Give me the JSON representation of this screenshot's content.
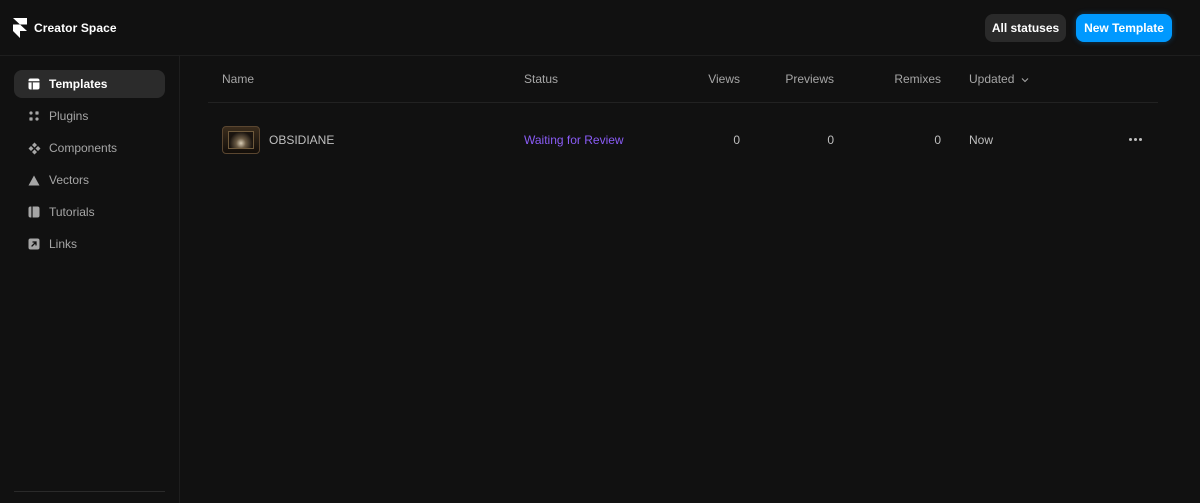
{
  "brand": {
    "name": "Creator Space",
    "logo_icon": "framer-logo-icon"
  },
  "header": {
    "status_filter_label": "All statuses",
    "new_template_label": "New Template",
    "accent_color": "#0099ff"
  },
  "sidebar": {
    "items": [
      {
        "label": "Templates",
        "icon": "template-icon",
        "active": true
      },
      {
        "label": "Plugins",
        "icon": "plugin-icon",
        "active": false
      },
      {
        "label": "Components",
        "icon": "components-icon",
        "active": false
      },
      {
        "label": "Vectors",
        "icon": "vector-triangle-icon",
        "active": false
      },
      {
        "label": "Tutorials",
        "icon": "book-icon",
        "active": false
      },
      {
        "label": "Links",
        "icon": "link-arrow-icon",
        "active": false
      }
    ]
  },
  "table": {
    "columns": {
      "name": "Name",
      "status": "Status",
      "views": "Views",
      "previews": "Previews",
      "remixes": "Remixes",
      "updated": "Updated"
    },
    "rows": [
      {
        "name": "OBSIDIANE",
        "status": "Waiting for Review",
        "status_color": "#8a5cf6",
        "views": "0",
        "previews": "0",
        "remixes": "0",
        "updated": "Now"
      }
    ]
  }
}
